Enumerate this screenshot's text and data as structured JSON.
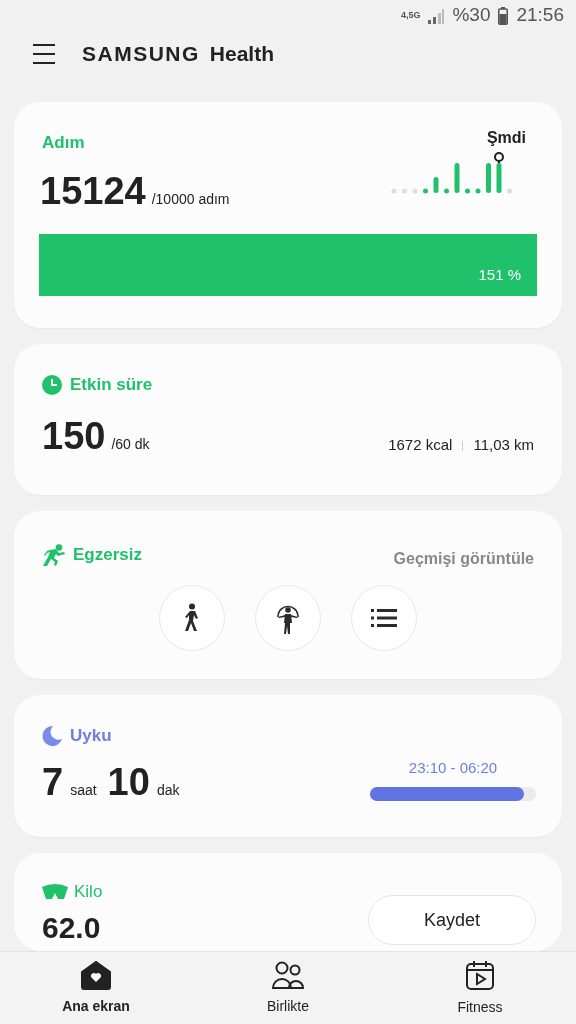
{
  "status_bar": {
    "network": "4,5G",
    "battery": "%30",
    "time": "21:56"
  },
  "header": {
    "brand": "SAMSUNG",
    "product": "Health"
  },
  "steps": {
    "title": "Adım",
    "value": "15124",
    "goal": "/10000 adım",
    "now_label": "Şmdi",
    "level": 1,
    "percent": "151 %"
  },
  "active_time": {
    "title": "Etkin süre",
    "value": "150",
    "goal": "/60 dk",
    "calories": "1672 kcal",
    "distance": "11,03 km"
  },
  "exercise": {
    "title": "Egzersiz",
    "link": "Geçmişi görüntüle",
    "shortcuts": [
      {
        "kind": "walk"
      },
      {
        "kind": "rope"
      },
      {
        "kind": "list"
      }
    ]
  },
  "sleep": {
    "title": "Uyku",
    "hours": "7",
    "hours_unit": "saat",
    "minutes": "10",
    "minutes_unit": "dak",
    "range": "23:10 - 06:20",
    "level": 0.93
  },
  "weight": {
    "title": "Kilo",
    "value": "62.0",
    "button": "Kaydet"
  },
  "bottom_nav": [
    {
      "label": "Ana ekran",
      "kind": "home",
      "selected": true
    },
    {
      "label": "Birlikte",
      "kind": "together",
      "selected": false
    },
    {
      "label": "Fitness",
      "kind": "fitness",
      "selected": false
    }
  ]
}
